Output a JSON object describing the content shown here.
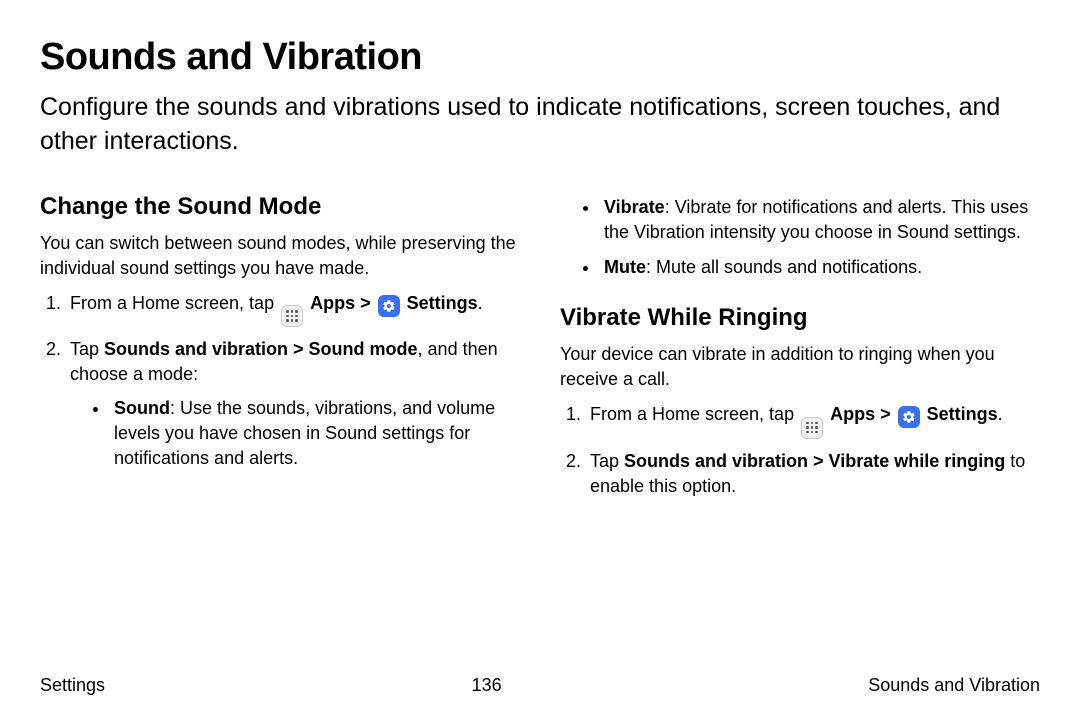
{
  "title": "Sounds and Vibration",
  "intro": "Configure the sounds and vibrations used to indicate notifications, screen touches, and other interactions.",
  "left": {
    "heading": "Change the Sound Mode",
    "desc": "You can switch between sound modes, while preserving the individual sound settings you have made.",
    "step1_prefix": "From a Home screen, tap ",
    "apps_label": "Apps",
    "chevron": " > ",
    "settings_label": "Settings",
    "period": ".",
    "step2_prefix": "Tap ",
    "step2_bold": "Sounds and vibration > Sound mode",
    "step2_suffix": ", and then choose a mode:",
    "sound_bold": "Sound",
    "sound_desc": ": Use the sounds, vibrations, and volume levels you have chosen in Sound settings for notifications and alerts."
  },
  "right": {
    "vibrate_bold": "Vibrate",
    "vibrate_desc": ": Vibrate for notifications and alerts. This uses the Vibration intensity you choose in Sound settings.",
    "mute_bold": "Mute",
    "mute_desc": ": Mute all sounds and notifications.",
    "heading2": "Vibrate While Ringing",
    "desc2": "Your device can vibrate in addition to ringing when you receive a call.",
    "step1_prefix": "From a Home screen, tap ",
    "apps_label": "Apps",
    "chevron": " > ",
    "settings_label": "Settings",
    "period": ".",
    "step2_prefix": "Tap ",
    "step2_bold": "Sounds and vibration > Vibrate while ringing",
    "step2_suffix": " to enable this option."
  },
  "footer": {
    "left": "Settings",
    "center": "136",
    "right": "Sounds and Vibration"
  }
}
